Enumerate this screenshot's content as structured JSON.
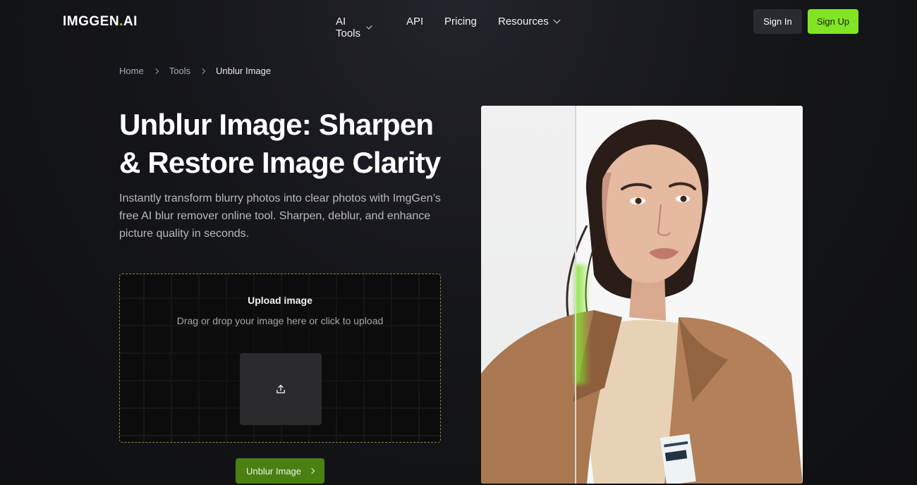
{
  "nav": {
    "logo": {
      "part1": "IMGGEN",
      "part2": ".",
      "part3": "AI"
    },
    "links": [
      {
        "label": "AI Tools",
        "has_dropdown": true
      },
      {
        "label": "API",
        "has_dropdown": false
      },
      {
        "label": "Pricing",
        "has_dropdown": false
      },
      {
        "label": "Resources",
        "has_dropdown": true
      }
    ],
    "sign_in": "Sign In",
    "sign_up": "Sign Up"
  },
  "breadcrumb": [
    "Home",
    "Tools",
    "Unblur Image"
  ],
  "hero": {
    "title": "Unblur Image: Sharpen & Restore Image Clarity",
    "description": "Instantly transform blurry photos into clear photos with ImgGen’s free AI blur remover online tool. Sharpen, deblur, and enhance picture quality in seconds."
  },
  "upload": {
    "title": "Upload image",
    "subtitle": "Drag or drop your image here or click to upload",
    "icon": "upload-icon"
  },
  "cta": {
    "label": "Unblur Image",
    "icon": "chevron-right-icon"
  },
  "colors": {
    "accent": "#82e524",
    "cta_bg": "#4a7f12",
    "background": "#15161a"
  }
}
